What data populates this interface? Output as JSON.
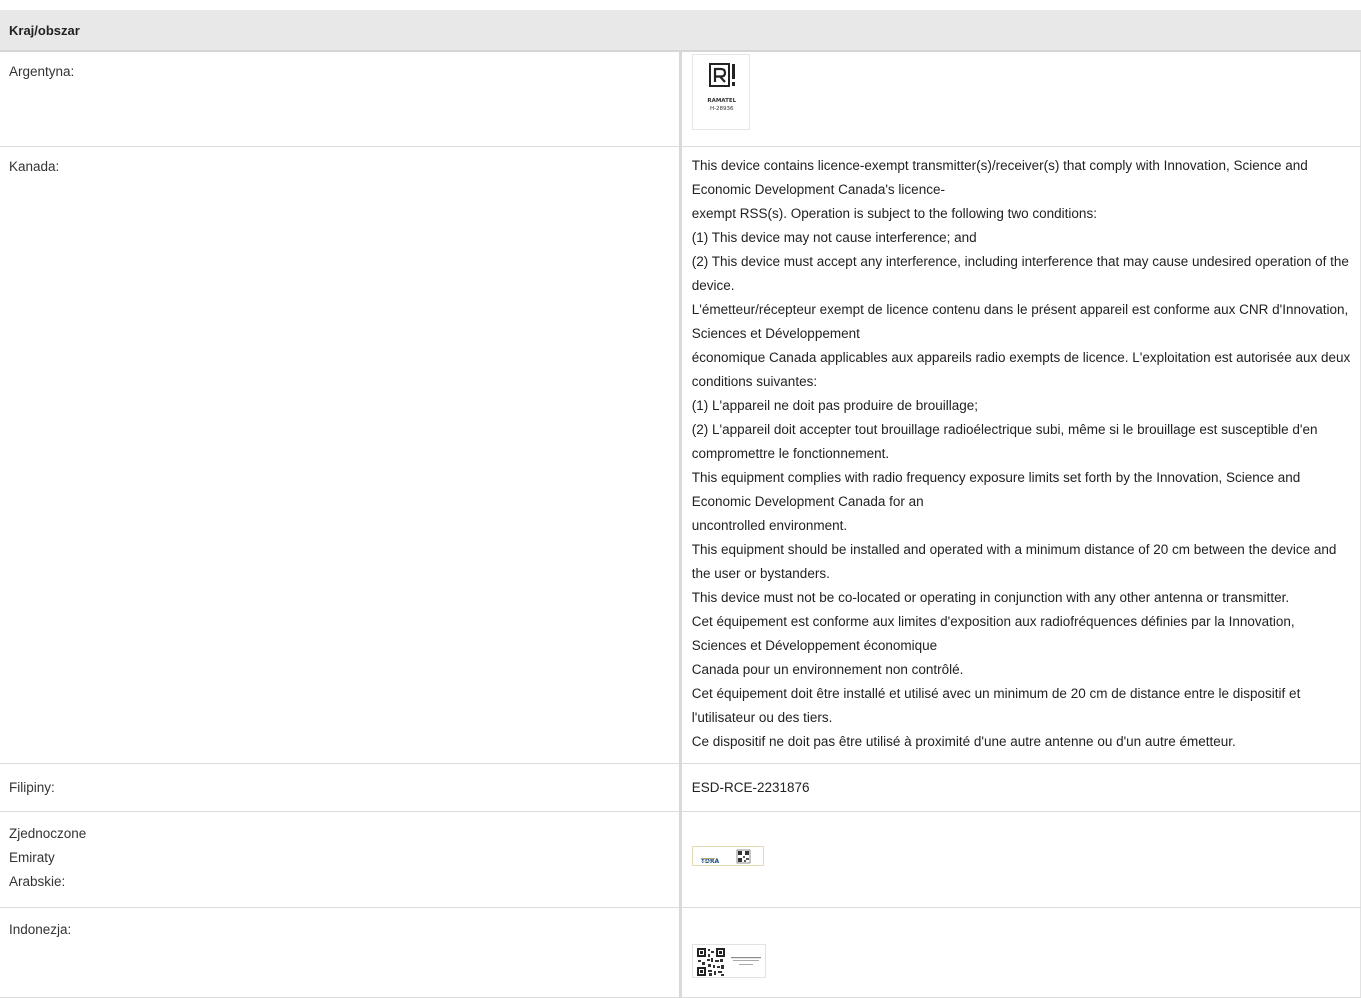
{
  "header": {
    "label": "Kraj/obszar"
  },
  "rows": [
    {
      "country": "Argentyna:",
      "logo": {
        "icon": "ramatel-logo-icon",
        "text": "RAMATEL",
        "code": "H-28936"
      }
    },
    {
      "country": "Kanada:",
      "lines": [
        "This device contains licence-exempt transmitter(s)/receiver(s) that comply with Innovation, Science and Economic Development Canada's licence-",
        "exempt RSS(s). Operation is subject to the following two conditions:",
        "(1) This device may not cause interference; and",
        "(2) This device must accept any interference, including interference that may cause undesired operation of the device.",
        "L'émetteur/récepteur exempt de licence contenu dans le présent appareil est conforme aux CNR d'Innovation, Sciences et Développement",
        "économique Canada applicables aux appareils radio exempts de licence. L'exploitation est autorisée aux deux conditions suivantes:",
        "(1) L'appareil ne doit pas produire de brouillage;",
        "(2) L'appareil doit accepter tout brouillage radioélectrique subi, même si le brouillage est susceptible d'en compromettre le fonctionnement.",
        "This equipment complies with radio frequency exposure limits set forth by the Innovation, Science and Economic Development Canada for an",
        "uncontrolled environment.",
        "This equipment should be installed and operated with a minimum distance of 20 cm between the device and the user or bystanders.",
        "This device must not be co-located or operating in conjunction with any other antenna or transmitter.",
        "Cet équipement est conforme aux limites d'exposition aux radiofréquences définies par la Innovation, Sciences et Développement économique",
        "Canada pour un environnement non contrôlé.",
        "Cet équipement doit être installé et utilisé avec un minimum de 20 cm de distance entre le dispositif et l'utilisateur ou des tiers.",
        "Ce dispositif ne doit pas être utilisé à proximité d'une autre antenne ou d'un autre émetteur."
      ]
    },
    {
      "country": "Filipiny:",
      "value": "ESD-RCE-2231876"
    },
    {
      "country_lines": [
        "Zjednoczone",
        "Emiraty",
        "Arabskie:"
      ],
      "logo": {
        "icon": "tdra-label-icon",
        "text": "TDRA"
      }
    },
    {
      "country": "Indonezja:",
      "logo": {
        "icon": "indonesia-qr-label-icon"
      }
    }
  ]
}
